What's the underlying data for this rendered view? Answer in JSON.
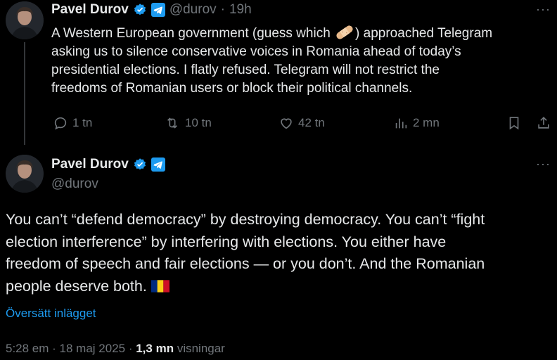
{
  "tweet1": {
    "name": "Pavel Durov",
    "handle": "@durov",
    "sep": "·",
    "time": "19h",
    "text_a": "A Western European government (guess which ",
    "text_b": ") approached Telegram",
    "text_lines": [
      "asking us to silence conservative voices in Romania ahead of today’s",
      "presidential elections. I flatly refused. Telegram will not restrict the",
      "freedoms of Romanian users or block their political channels."
    ],
    "actions": {
      "replies": "1 tn",
      "reposts": "10 tn",
      "likes": "42 tn",
      "views": "2 mn"
    },
    "more": "···"
  },
  "tweet2": {
    "name": "Pavel Durov",
    "handle": "@durov",
    "more": "···",
    "text_lines": [
      "You can’t “defend democracy” by destroying democracy. You can’t “fight",
      "election interference” by interfering with elections. You either have",
      "freedom of speech and fair elections — or you don’t. And the Romanian",
      "people deserve both."
    ],
    "translate": "Översätt inlägget",
    "timestamp": "5:28 em · 18 maj 2025 ·",
    "views_count": "1,3 mn",
    "views_label": "visningar"
  },
  "colors": {
    "background": "#000000",
    "text": "#e7e9ea",
    "muted": "#71767b",
    "accent": "#1d9bf0"
  },
  "icons": [
    "verified-badge-icon",
    "telegram-icon",
    "reply-icon",
    "repost-icon",
    "like-icon",
    "views-icon",
    "bookmark-icon",
    "share-icon",
    "bandaid-emoji-icon",
    "romania-flag-emoji-icon"
  ]
}
